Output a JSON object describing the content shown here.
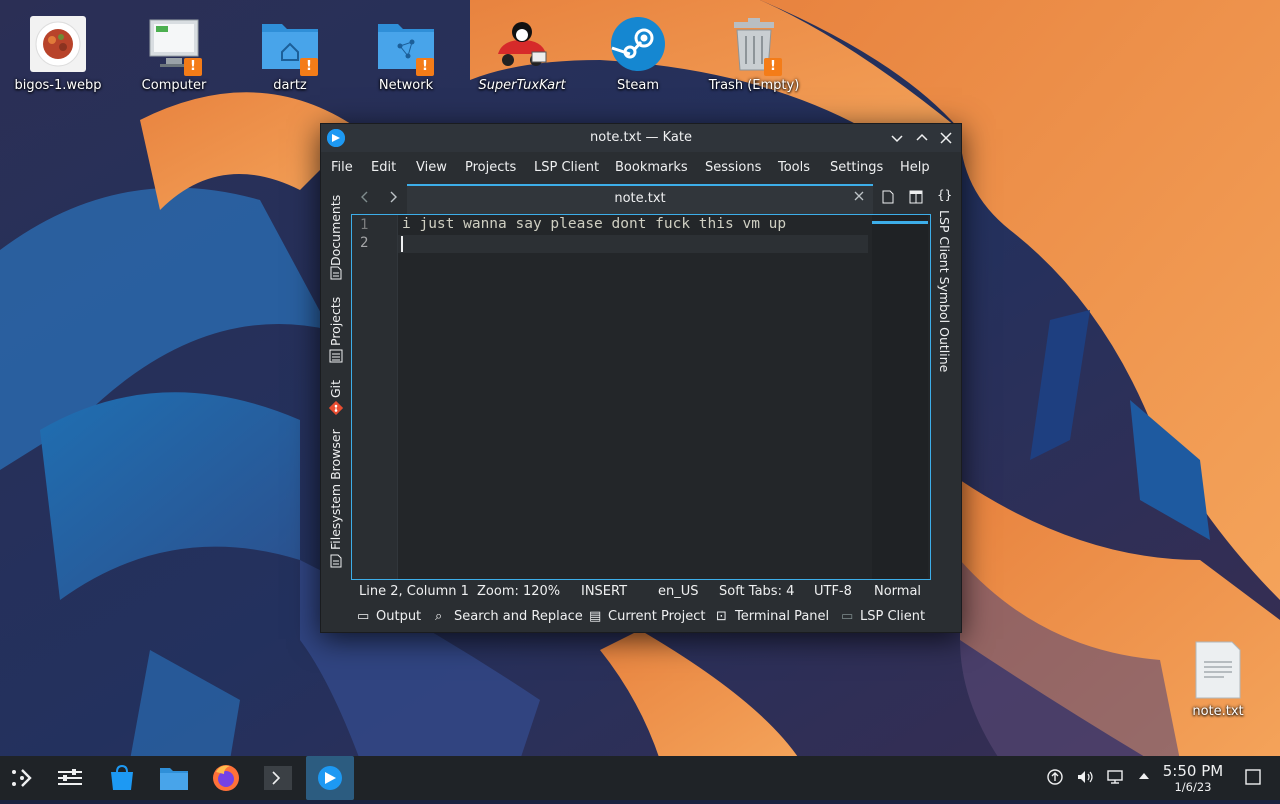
{
  "desktop": {
    "icons": [
      {
        "label": "bigos-1.webp",
        "icon": "image-file-icon"
      },
      {
        "label": "Computer",
        "icon": "computer-icon"
      },
      {
        "label": "dartz",
        "icon": "home-folder-icon"
      },
      {
        "label": "Network",
        "icon": "network-folder-icon"
      },
      {
        "label": "SuperTuxKart",
        "icon": "supertuxkart-icon"
      },
      {
        "label": "Steam",
        "icon": "steam-icon"
      },
      {
        "label": "Trash (Empty)",
        "icon": "trash-icon"
      },
      {
        "label": "note.txt",
        "icon": "text-file-icon"
      }
    ]
  },
  "window": {
    "title": "note.txt — Kate",
    "menu": [
      "File",
      "Edit",
      "View",
      "Projects",
      "LSP Client",
      "Bookmarks",
      "Sessions",
      "Tools",
      "Settings",
      "Help"
    ],
    "left_panels": [
      "Documents",
      "Projects",
      "Git",
      "Filesystem Browser"
    ],
    "right_panels": [
      "LSP Client Symbol Outline"
    ],
    "right_panel_glyph": "{}",
    "tab": {
      "title": "note.txt"
    },
    "editor": {
      "lines": [
        {
          "number": "1",
          "text": "i just wanna say please dont fuck this vm up"
        },
        {
          "number": "2",
          "text": ""
        }
      ]
    },
    "status": {
      "position": "Line 2, Column 1",
      "zoom": "Zoom: 120%",
      "mode": "INSERT",
      "language": "en_US",
      "indent": "Soft Tabs: 4",
      "encoding": "UTF-8",
      "input_mode": "Normal"
    },
    "bottom_panels": [
      "Output",
      "Search and Replace",
      "Current Project",
      "Terminal Panel",
      "LSP Client"
    ]
  },
  "taskbar": {
    "clock": {
      "time": "5:50 PM",
      "date": "1/6/23"
    }
  },
  "colors": {
    "accent": "#3daee9",
    "window_bg": "#2a2e32",
    "editor_bg": "#232629",
    "taskbar_bg": "#1f2327"
  }
}
